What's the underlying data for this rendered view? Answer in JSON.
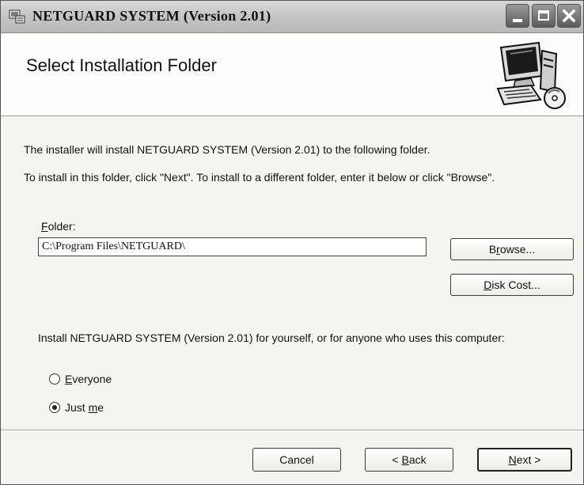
{
  "window": {
    "title": "NETGUARD SYSTEM (Version 2.01)"
  },
  "header": {
    "title": "Select Installation Folder",
    "graphic_icon": "computer-install-icon"
  },
  "body": {
    "line1": "The installer will install NETGUARD SYSTEM (Version 2.01) to the following folder.",
    "line2": "To install in this folder, click \"Next\". To install to a different folder, enter it below or click \"Browse\".",
    "folder_label": {
      "mnemonic": "F",
      "rest": "older:"
    },
    "folder_value": "C:\\Program Files\\NETGUARD\\",
    "browse": {
      "before": "B",
      "mnemonic": "r",
      "after": "owse..."
    },
    "disk_cost": {
      "mnemonic": "D",
      "after": "isk Cost..."
    },
    "install_for": "Install NETGUARD SYSTEM (Version 2.01) for yourself, or for anyone who uses this computer:",
    "options": {
      "everyone": {
        "mnemonic": "E",
        "after": "veryone",
        "selected": false
      },
      "just_me": {
        "before": "Just ",
        "mnemonic": "m",
        "after": "e",
        "selected": true
      }
    }
  },
  "footer": {
    "cancel": "Cancel",
    "back": {
      "prefix": "< ",
      "mnemonic": "B",
      "after": "ack"
    },
    "next": {
      "mnemonic": "N",
      "after": "ext >"
    }
  },
  "colors": {
    "title_bar": "#c4c4c4",
    "header_bg": "#fdfdfb",
    "dialog_bg": "#f4f4f1"
  }
}
